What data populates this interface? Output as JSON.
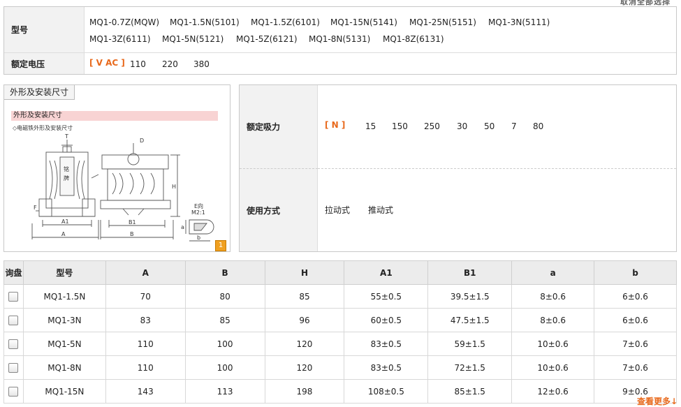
{
  "top": {
    "clear_all": "取消全部选择"
  },
  "filters": {
    "model": {
      "label": "型号",
      "row1": [
        "MQ1-0.7Z(MQW)",
        "MQ1-1.5N(5101)",
        "MQ1-1.5Z(6101)",
        "MQ1-15N(5141)",
        "MQ1-25N(5151)",
        "MQ1-3N(5111)"
      ],
      "row2": [
        "MQ1-3Z(6111)",
        "MQ1-5N(5121)",
        "MQ1-5Z(6121)",
        "MQ1-8N(5131)",
        "MQ1-8Z(6131)"
      ]
    },
    "voltage": {
      "label": "额定电压",
      "unit": "[ V AC ]",
      "values": [
        "110",
        "220",
        "380"
      ]
    }
  },
  "diagram": {
    "tab": "外形及安装尺寸",
    "heading": "外形及安装尺寸",
    "caption": "◇电磁铁外形及安装尺寸",
    "labels": {
      "T": "T",
      "D": "D",
      "H": "H",
      "F": "F",
      "A1": "A1",
      "A": "A",
      "B1": "B1",
      "B": "B",
      "e": "E向",
      "m": "M2:1",
      "a": "a",
      "b": "b",
      "plate1": "铭",
      "plate2": "牌"
    },
    "badge": "1"
  },
  "specs": {
    "force": {
      "label": "额定吸力",
      "unit": "[ N ]",
      "values": [
        "15",
        "150",
        "250",
        "30",
        "50",
        "7",
        "80"
      ]
    },
    "mode": {
      "label": "使用方式",
      "values": [
        "拉动式",
        "推动式"
      ]
    }
  },
  "table": {
    "headers": [
      "询盘",
      "型号",
      "A",
      "B",
      "H",
      "A1",
      "B1",
      "a",
      "b"
    ],
    "rows": [
      [
        "MQ1-1.5N",
        "70",
        "80",
        "85",
        "55±0.5",
        "39.5±1.5",
        "8±0.6",
        "6±0.6"
      ],
      [
        "MQ1-3N",
        "83",
        "85",
        "96",
        "60±0.5",
        "47.5±1.5",
        "8±0.6",
        "6±0.6"
      ],
      [
        "MQ1-5N",
        "110",
        "100",
        "120",
        "83±0.5",
        "59±1.5",
        "10±0.6",
        "7±0.6"
      ],
      [
        "MQ1-8N",
        "110",
        "100",
        "120",
        "83±0.5",
        "72±1.5",
        "10±0.6",
        "7±0.6"
      ],
      [
        "MQ1-15N",
        "143",
        "113",
        "198",
        "108±0.5",
        "85±1.5",
        "12±0.6",
        "9±0.6"
      ]
    ]
  },
  "more": "查看更多↓"
}
